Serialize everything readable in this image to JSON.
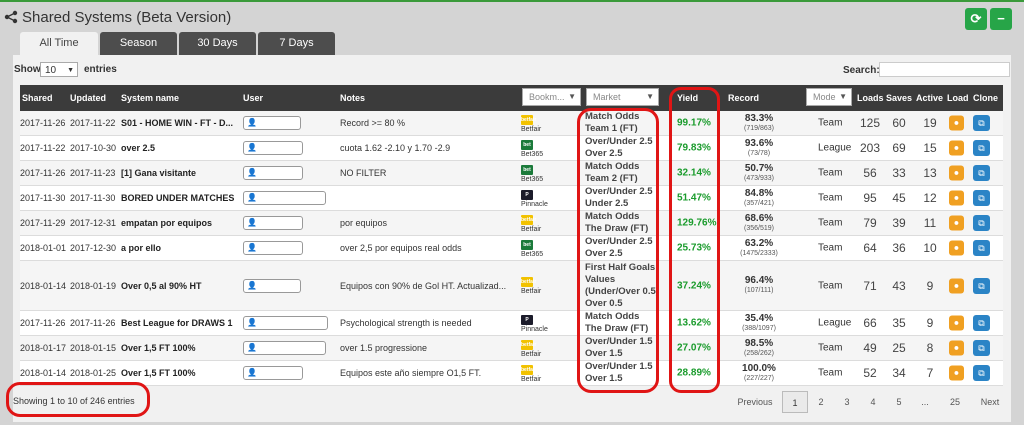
{
  "header": {
    "title": "Shared Systems (Beta Version)",
    "refresh_icon": "refresh-icon",
    "minimize_icon": "minus-icon",
    "accent": "#27a548"
  },
  "tabs": [
    "All Time",
    "Season",
    "30 Days",
    "7 Days"
  ],
  "controls": {
    "show_label": "Show",
    "show_value": "10",
    "entries_label": "entries",
    "search_label": "Search:"
  },
  "columns": {
    "shared": "Shared",
    "updated": "Updated",
    "system_name": "System name",
    "user": "User",
    "notes": "Notes",
    "bookmaker": "Bookm...",
    "market": "Market",
    "yield": "Yield",
    "record": "Record",
    "mode": "Mode",
    "loads": "Loads",
    "saves": "Saves",
    "active": "Active",
    "load": "Load",
    "clone": "Clone"
  },
  "rows": [
    {
      "shared": "2017-11-26",
      "updated": "2017-11-22",
      "name": "S01 - HOME WIN - FT - D...",
      "user": "",
      "notes": "Record >= 80 %",
      "bookmaker": "Betfair",
      "market1": "Match Odds",
      "market2": "Team 1 (FT)",
      "market3": "",
      "market4": "",
      "yield": "99.17%",
      "record_pct": "83.3%",
      "record_count": "(719/863)",
      "mode": "Team",
      "loads": "125",
      "saves": "60",
      "active": "19"
    },
    {
      "shared": "2017-11-22",
      "updated": "2017-10-30",
      "name": "over 2.5",
      "user": "",
      "notes": "cuota 1.62 -2.10 y 1.70 -2.9",
      "bookmaker": "Bet365",
      "market1": "Over/Under 2.5",
      "market2": "Over 2.5",
      "market3": "",
      "market4": "",
      "yield": "79.83%",
      "record_pct": "93.6%",
      "record_count": "(73/78)",
      "mode": "League",
      "loads": "203",
      "saves": "69",
      "active": "15"
    },
    {
      "shared": "2017-11-26",
      "updated": "2017-11-23",
      "name": "[1] Gana visitante",
      "user": "",
      "notes": "NO FILTER",
      "bookmaker": "Bet365",
      "market1": "Match Odds",
      "market2": "Team 2 (FT)",
      "market3": "",
      "market4": "",
      "yield": "32.14%",
      "record_pct": "50.7%",
      "record_count": "(473/933)",
      "mode": "Team",
      "loads": "56",
      "saves": "33",
      "active": "13"
    },
    {
      "shared": "2017-11-30",
      "updated": "2017-11-30",
      "name": "BORED UNDER MATCHES",
      "user": "",
      "notes": "",
      "bookmaker": "Pinnacle",
      "market1": "Over/Under 2.5",
      "market2": "Under 2.5",
      "market3": "",
      "market4": "",
      "yield": "51.47%",
      "record_pct": "84.8%",
      "record_count": "(357/421)",
      "mode": "Team",
      "loads": "95",
      "saves": "45",
      "active": "12"
    },
    {
      "shared": "2017-11-29",
      "updated": "2017-12-31",
      "name": "empatan por equipos",
      "user": "",
      "notes": "por equipos",
      "bookmaker": "Betfair",
      "market1": "Match Odds",
      "market2": "The Draw (FT)",
      "market3": "",
      "market4": "",
      "yield": "129.76%",
      "record_pct": "68.6%",
      "record_count": "(356/519)",
      "mode": "Team",
      "loads": "79",
      "saves": "39",
      "active": "11"
    },
    {
      "shared": "2018-01-01",
      "updated": "2017-12-30",
      "name": "a por ello",
      "user": "",
      "notes": "over 2,5 por equipos real odds",
      "bookmaker": "Bet365",
      "market1": "Over/Under 2.5",
      "market2": "Over 2.5",
      "market3": "",
      "market4": "",
      "yield": "25.73%",
      "record_pct": "63.2%",
      "record_count": "(1475/2333)",
      "mode": "Team",
      "loads": "64",
      "saves": "36",
      "active": "10"
    },
    {
      "shared": "2018-01-14",
      "updated": "2018-01-19",
      "name": "Over 0,5 al 90% HT",
      "user": "",
      "notes": "Equipos con 90% de Gol HT. Actualizad...",
      "bookmaker": "Betfair",
      "market1": "First Half Goals",
      "market2": "Values",
      "market3": "(Under/Over 0.5)",
      "market4": "Over 0.5",
      "yield": "37.24%",
      "record_pct": "96.4%",
      "record_count": "(107/111)",
      "mode": "Team",
      "loads": "71",
      "saves": "43",
      "active": "9"
    },
    {
      "shared": "2017-11-26",
      "updated": "2017-11-26",
      "name": "Best League for DRAWS 1",
      "user": "",
      "notes": "Psychological strength is needed",
      "bookmaker": "Pinnacle",
      "market1": "Match Odds",
      "market2": "The Draw (FT)",
      "market3": "",
      "market4": "",
      "yield": "13.62%",
      "record_pct": "35.4%",
      "record_count": "(388/1097)",
      "mode": "League",
      "loads": "66",
      "saves": "35",
      "active": "9"
    },
    {
      "shared": "2018-01-17",
      "updated": "2018-01-15",
      "name": "Over 1,5 FT 100%",
      "user": "",
      "notes": "over 1.5 progressione",
      "bookmaker": "Betfair",
      "market1": "Over/Under 1.5",
      "market2": "Over 1.5",
      "market3": "",
      "market4": "",
      "yield": "27.07%",
      "record_pct": "98.5%",
      "record_count": "(258/262)",
      "mode": "Team",
      "loads": "49",
      "saves": "25",
      "active": "8"
    },
    {
      "shared": "2018-01-14",
      "updated": "2018-01-25",
      "name": "Over 1,5 FT 100%",
      "user": "",
      "notes": "Equipos este año siempre O1,5 FT.",
      "bookmaker": "Betfair",
      "market1": "Over/Under 1.5",
      "market2": "Over 1.5",
      "market3": "",
      "market4": "",
      "yield": "28.89%",
      "record_pct": "100.0%",
      "record_count": "(227/227)",
      "mode": "Team",
      "loads": "52",
      "saves": "34",
      "active": "7"
    }
  ],
  "footer": {
    "info": "Showing 1 to 10 of 246 entries"
  },
  "pagination": [
    "Previous",
    "1",
    "2",
    "3",
    "4",
    "5",
    "...",
    "25",
    "Next"
  ],
  "colors": {
    "yield_green": "#1a9b2c",
    "highlight_red": "#e01515",
    "header_dark": "#3b3b3b"
  }
}
